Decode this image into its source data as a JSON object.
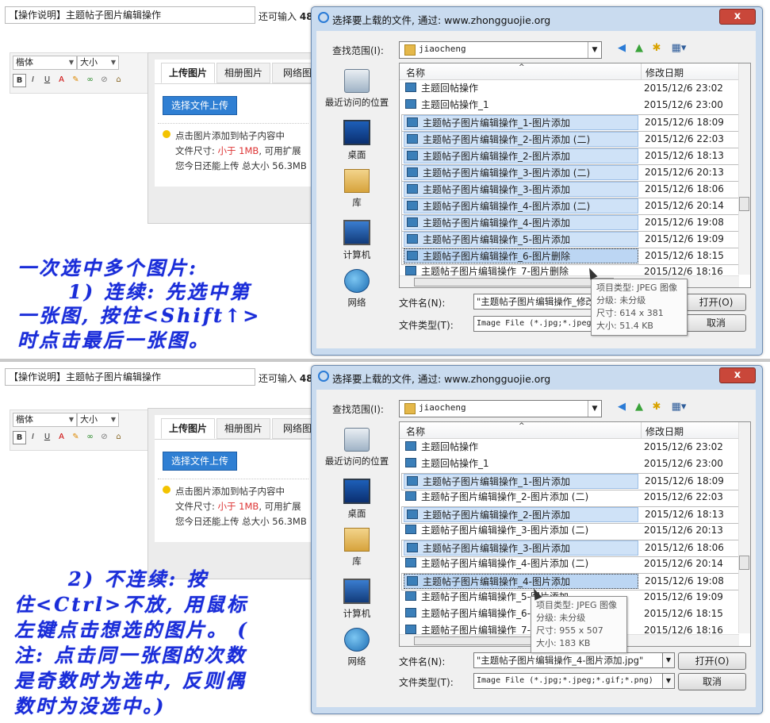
{
  "editor": {
    "title_value": "【操作说明】主题帖子图片编辑操作",
    "remain_label": "还可输入",
    "remain_count": "48",
    "font_select": "楷体",
    "size_select": "大小",
    "tb_bold": "B",
    "tb_italic": "I",
    "tb_underline": "U",
    "tb_color": "A"
  },
  "upload": {
    "tabs": [
      "上传图片",
      "相册图片",
      "网络图"
    ],
    "choose_button": "选择文件上传",
    "tip_line1": "点击图片添加到帖子内容中",
    "tip_line2_prefix": "文件尺寸: ",
    "tip_line2_red": "小于 1MB",
    "tip_line2_suffix": ", 可用扩展",
    "tip_line3": "您今日还能上传 总大小 56.3MB"
  },
  "annotation_top": {
    "line1": "一次选中多个图片:",
    "line2": "1) 连续: 先选中第",
    "line3": "一张图, 按住<Shift↑>",
    "line4": "时点击最后一张图。"
  },
  "annotation_bottom": {
    "line1": "2) 不连续: 按",
    "line2": "住<Ctrl>不放, 用鼠标",
    "line3": "左键点击想选的图片。 (",
    "line4": "注: 点击同一张图的次数",
    "line5": "是奇数时为选中, 反则偶",
    "line6": "数时为没选中。)"
  },
  "dialog": {
    "title": "选择要上载的文件, 通过: www.zhongguojie.org",
    "close": "x",
    "lookin_label": "查找范围(I):",
    "lookin_value": "jiaocheng",
    "col_name": "名称",
    "col_date": "修改日期",
    "places": [
      "最近访问的位置",
      "桌面",
      "库",
      "计算机",
      "网络"
    ],
    "filename_label": "文件名(N):",
    "filetype_label": "文件类型(T):",
    "open_button": "打开(O)",
    "cancel_button": "取消",
    "files": [
      {
        "name": "主题回帖操作",
        "date": "2015/12/6 23:02"
      },
      {
        "name": "主题回帖操作_1",
        "date": "2015/12/6 23:00"
      },
      {
        "name": "主题帖子图片编辑操作_1-图片添加",
        "date": "2015/12/6 18:09"
      },
      {
        "name": "主题帖子图片编辑操作_2-图片添加 (二)",
        "date": "2015/12/6 22:03"
      },
      {
        "name": "主题帖子图片编辑操作_2-图片添加",
        "date": "2015/12/6 18:13"
      },
      {
        "name": "主题帖子图片编辑操作_3-图片添加 (二)",
        "date": "2015/12/6 20:13"
      },
      {
        "name": "主题帖子图片编辑操作_3-图片添加",
        "date": "2015/12/6 18:06"
      },
      {
        "name": "主题帖子图片编辑操作_4-图片添加 (二)",
        "date": "2015/12/6 20:14"
      },
      {
        "name": "主题帖子图片编辑操作_4-图片添加",
        "date": "2015/12/6 19:08"
      },
      {
        "name": "主题帖子图片编辑操作_5-图片添加",
        "date": "2015/12/6 19:09"
      },
      {
        "name": "主题帖子图片编辑操作_6-图片删除",
        "date": "2015/12/6 18:15"
      },
      {
        "name": "主题帖子图片编辑操作_7-图片删除",
        "date": "2015/12/6 18:16"
      }
    ]
  },
  "dialog1": {
    "filename_value": "\"主题帖子图片编辑操作_修改",
    "filetype_value": "Image File (*.jpg;*.jpeg",
    "tooltip_type": "项目类型: JPEG 图像",
    "tooltip_rating": "分级: 未分级",
    "tooltip_dims": "尺寸: 614 x 381",
    "tooltip_size": "大小: 51.4 KB"
  },
  "dialog2": {
    "filename_value": "\"主题帖子图片编辑操作_4-图片添加.jpg\"",
    "filetype_value": "Image File (*.jpg;*.jpeg;*.gif;*.png)",
    "tooltip_type": "项目类型: JPEG 图像",
    "tooltip_rating": "分级: 未分级",
    "tooltip_dims": "尺寸: 955 x 507",
    "tooltip_size": "大小: 183 KB"
  }
}
